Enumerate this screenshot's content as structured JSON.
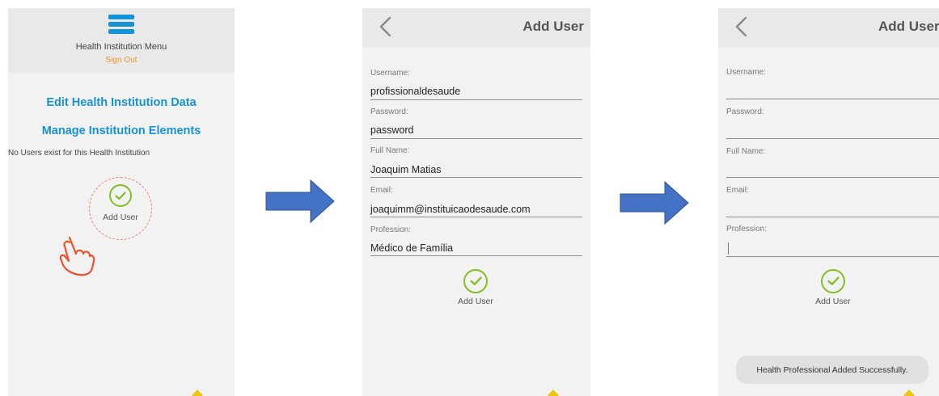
{
  "screen1": {
    "menu_title": "Health Institution Menu",
    "sign_out": "Sign Out",
    "edit_link": "Edit Health Institution Data",
    "manage_link": "Manage Institution Elements",
    "no_users": "No Users exist for this Health Institution",
    "add_user": "Add User"
  },
  "screen2": {
    "title": "Add User",
    "fields": [
      {
        "label": "Username:",
        "value": "profissionaldesaude"
      },
      {
        "label": "Password:",
        "value": "password"
      },
      {
        "label": "Full Name:",
        "value": "Joaquim Matias"
      },
      {
        "label": "Email:",
        "value": "joaquimm@instituicaodesaude.com"
      },
      {
        "label": "Profession:",
        "value": "Médico de Família"
      }
    ],
    "add_user": "Add User"
  },
  "screen3": {
    "title": "Add User",
    "fields": [
      {
        "label": "Username:",
        "value": ""
      },
      {
        "label": "Password:",
        "value": ""
      },
      {
        "label": "Full Name:",
        "value": ""
      },
      {
        "label": "Email:",
        "value": ""
      },
      {
        "label": "Profession:",
        "value": ""
      }
    ],
    "add_user": "Add User",
    "toast": "Health Professional Added Successfully."
  },
  "colors": {
    "accent_blue": "#1592d4",
    "sign_out_orange": "#f0932b",
    "check_green": "#84bd24",
    "arrow_blue": "#4472c4",
    "hand_orange": "#e8522a",
    "triangle_yellow": "#f2c400"
  },
  "icons": [
    "hamburger-icon",
    "check-icon",
    "pointing-hand-icon",
    "back-chevron-icon",
    "right-arrow-icon"
  ]
}
